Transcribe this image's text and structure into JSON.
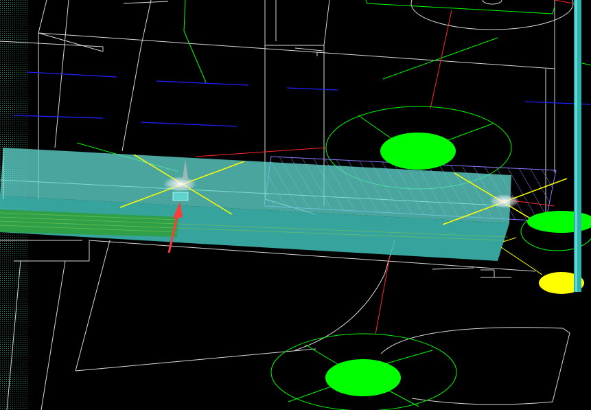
{
  "viewport": {
    "background": "#000000"
  },
  "colors": {
    "wireframe": "#d8d8d8",
    "cyan_solid": "#3fbfb8",
    "cyan_top": "#5fd3cc",
    "green": "#00ff00",
    "yellow": "#ffff00",
    "red": "#ff2a2a",
    "blue": "#2020ff",
    "hatch": "#8a7cff",
    "arrow": "#ff3b3b",
    "pipe": "#2bb3ad"
  },
  "icons": {
    "arrow": "red-arrow-icon",
    "highlight": "glow-highlight-icon"
  }
}
